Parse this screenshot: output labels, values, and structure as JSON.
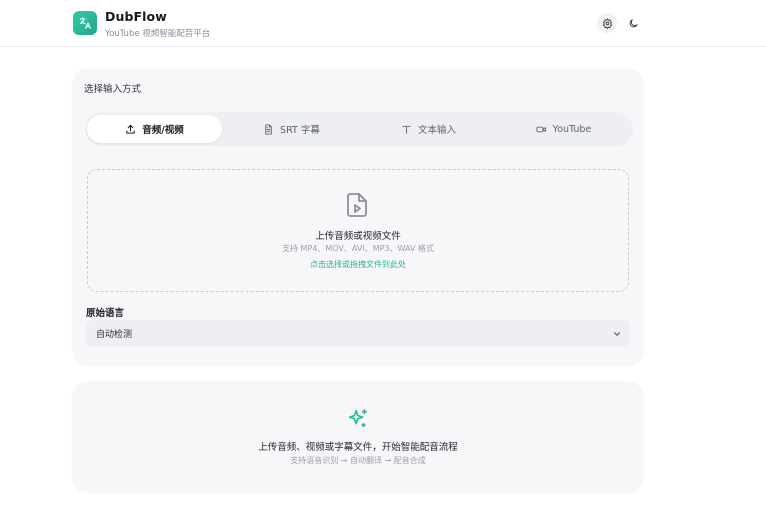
{
  "header": {
    "title": "DubFlow",
    "subtitle": "YouTube 视频智能配音平台",
    "logo_icon": "translate-icon",
    "brand_color": "#2bbd9c"
  },
  "input_card": {
    "title": "选择输入方式",
    "tabs": [
      {
        "label": "音频/视频",
        "icon": "upload-icon",
        "active": true
      },
      {
        "label": "SRT 字幕",
        "icon": "file-text-icon",
        "active": false
      },
      {
        "label": "文本输入",
        "icon": "text-icon",
        "active": false
      },
      {
        "label": "YouTube",
        "icon": "video-icon",
        "active": false
      }
    ],
    "dropzone": {
      "title": "上传音频或视频文件",
      "formats": "支持 MP4、MOV、AVI、MP3、WAV 格式",
      "action": "点击选择或拖拽文件到此处"
    },
    "language": {
      "label": "原始语言",
      "selected": "自动检测"
    }
  },
  "info_card": {
    "title": "上传音频、视频或字幕文件，开始智能配音流程",
    "subtitle": "支持语音识别 → 自动翻译 → 配音合成"
  }
}
